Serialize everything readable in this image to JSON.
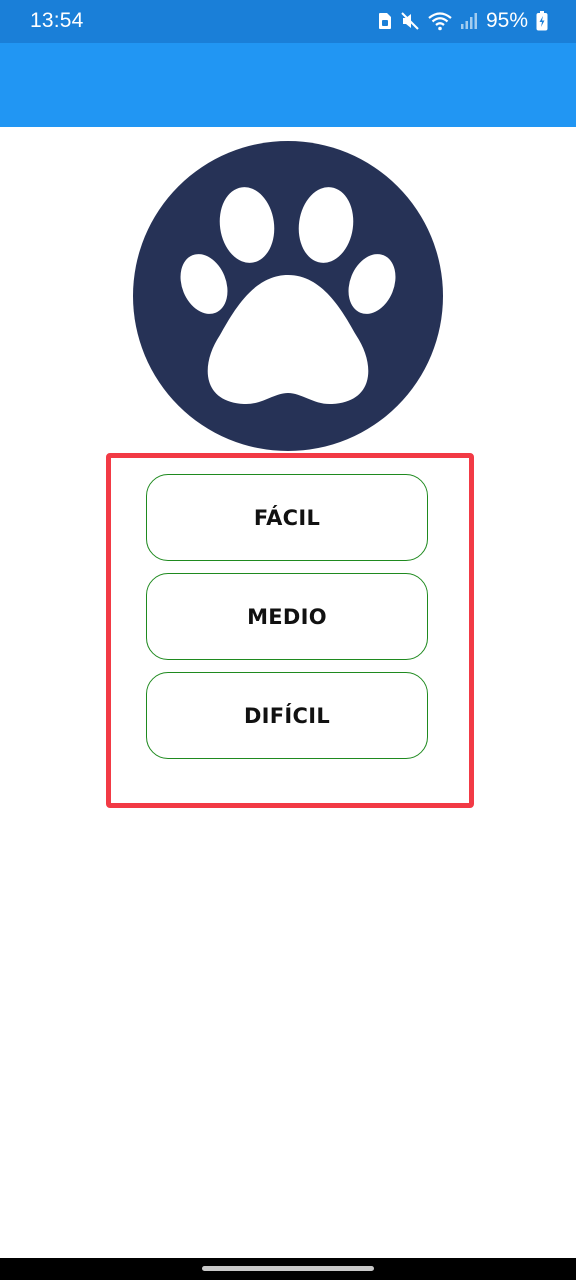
{
  "status_bar": {
    "time": "13:54",
    "battery_percent": "95%",
    "icons": [
      "sim-card-icon",
      "mute-icon",
      "wifi-icon",
      "signal-icon",
      "battery-icon"
    ]
  },
  "logo": {
    "icon": "paw-icon",
    "colors": {
      "circle": "#263256",
      "paw": "#ffffff"
    }
  },
  "difficulty": {
    "options": [
      {
        "label": "FÁCIL"
      },
      {
        "label": "MEDIO"
      },
      {
        "label": "DIFÍCIL"
      }
    ]
  },
  "colors": {
    "status_bar": "#1a7fd8",
    "app_bar": "#2196f3",
    "button_border": "#1f8a1f",
    "highlight": "#f23a45"
  }
}
